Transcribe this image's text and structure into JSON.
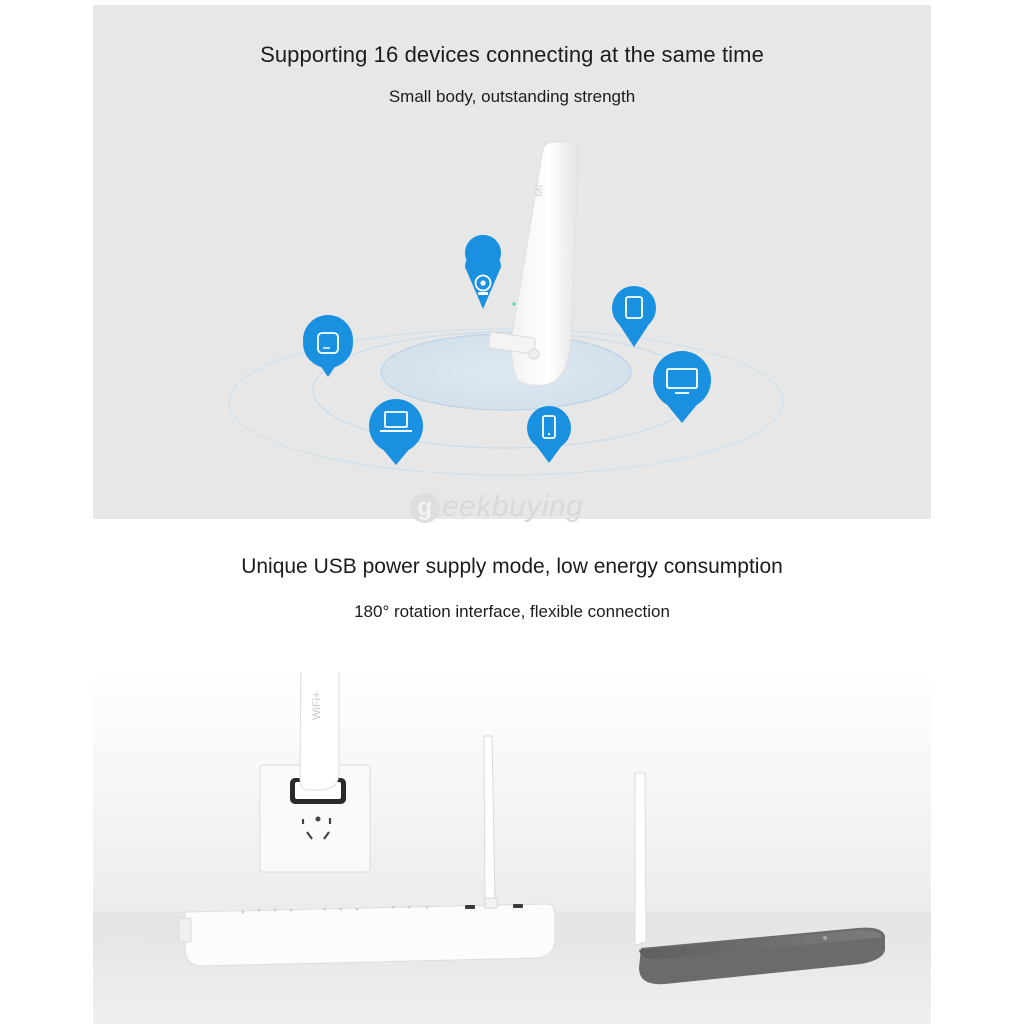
{
  "section1": {
    "title": "Supporting 16 devices connecting at the same time",
    "subtitle": "Small body, outstanding strength"
  },
  "section2": {
    "title": "Unique USB power supply mode, low energy consumption",
    "subtitle": "180° rotation interface, flexible connection"
  },
  "watermark": {
    "text": "eekbuying",
    "glyph": "g"
  },
  "device_logo": "MI",
  "device_label": "WiFi+",
  "colors": {
    "pin": "#1a90e0",
    "background": "#e7e7e7",
    "ring": "#c7dff0",
    "router": "#6b6b6b"
  },
  "icons": [
    "camera-icon",
    "tablet-icon",
    "hub-icon",
    "tv-icon",
    "laptop-icon",
    "phone-icon"
  ]
}
